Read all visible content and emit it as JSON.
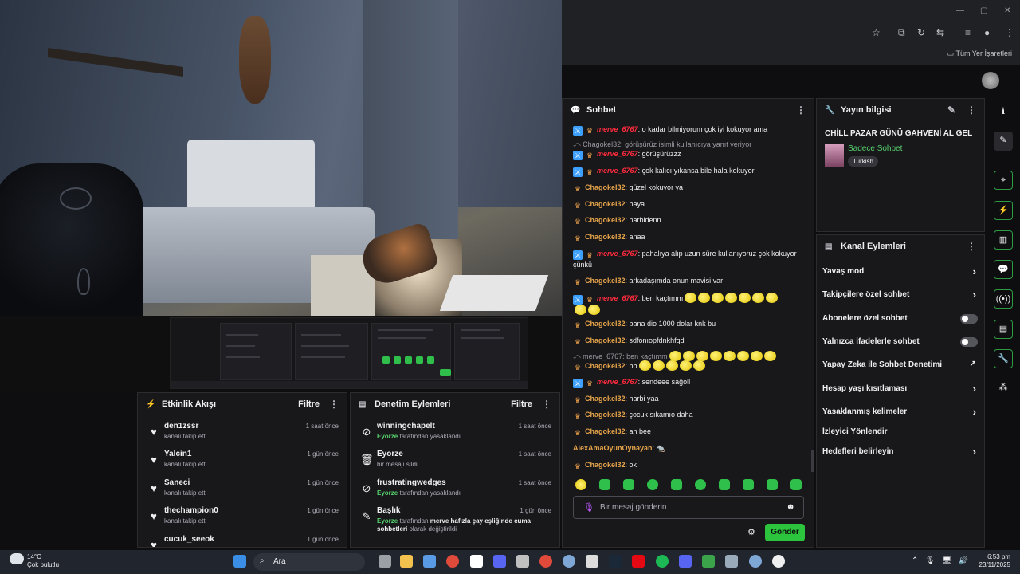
{
  "browser": {
    "bookmark_folder": "Tüm Yer İşaretleri"
  },
  "chat": {
    "title": "Sohbet",
    "messages": [
      {
        "user": "merve_6767",
        "text": ": o kadar bilmiyorum çok iyi kokuyor ama"
      },
      {
        "reply": "Chagokel32: görüşürüz isimli kullanıcıya yanıt veriyor"
      },
      {
        "user": "merve_6767",
        "text": ": görüşürüzzz"
      },
      {
        "user": "merve_6767",
        "text": ": çok kalıcı yıkansa bile hala kokuyor"
      },
      {
        "user": "Chagokel32",
        "text": ": güzel kokuyor ya"
      },
      {
        "user": "Chagokel32",
        "text": ": baya"
      },
      {
        "user": "Chagokel32",
        "text": ": harbidenn"
      },
      {
        "user": "Chagokel32",
        "text": ": anaa"
      },
      {
        "user": "merve_6767",
        "text": ": pahalıya alıp uzun süre kullanıyoruz çok kokuyor",
        "text2": "çünkü"
      },
      {
        "user": "Chagokel32",
        "text": ": arkadaşımda onun mavisi var"
      },
      {
        "user": "merve_6767",
        "text": ": ben kaçtımm"
      },
      {
        "user": "Chagokel32",
        "text": ": bana dio 1000 dolar knk bu"
      },
      {
        "user": "Chagokel32",
        "text": ": sdfonıopfdnkhfgd"
      },
      {
        "reply": "merve_6767: ben kaçtımm"
      },
      {
        "user": "Chagokel32",
        "text": ": bb"
      },
      {
        "user": "merve_6767",
        "text": ": sendeee sağoll"
      },
      {
        "user": "Chagokel32",
        "text": ": harbi yaa"
      },
      {
        "user": "Chagokel32",
        "text": ": çocuk sıkamıo daha"
      },
      {
        "user": "Chagokel32",
        "text": ": ah bee"
      },
      {
        "user": "AlexAmaOyunOynayan",
        "text": ":"
      },
      {
        "user": "Chagokel32",
        "text": ": ok"
      }
    ],
    "input_placeholder": "Bir mesaj gönderin",
    "send_label": "Gönder"
  },
  "stream_info": {
    "title": "Yayın bilgisi",
    "stream_title": "CHİLL PAZAR GÜNÜ GAHVENİ AL GEL",
    "category": "Sadece Sohbet",
    "tag": "Turkish"
  },
  "channel_actions": {
    "title": "Kanal Eylemleri",
    "items": [
      {
        "label": "Yavaş mod",
        "kind": "chevron"
      },
      {
        "label": "Takipçilere özel sohbet",
        "kind": "chevron"
      },
      {
        "label": "Abonelere özel sohbet",
        "kind": "toggle"
      },
      {
        "label": "Yalnızca ifadelerle sohbet",
        "kind": "toggle"
      },
      {
        "label": "Yapay Zeka ile Sohbet Denetimi",
        "kind": "external"
      },
      {
        "label": "Hesap yaşı kısıtlaması",
        "kind": "chevron"
      },
      {
        "label": "Yasaklanmış kelimeler",
        "kind": "chevron"
      },
      {
        "label": "İzleyici Yönlendir",
        "kind": "none"
      },
      {
        "label": "Hedefleri belirleyin",
        "kind": "chevron"
      }
    ]
  },
  "activity": {
    "title": "Etkinlik Akışı",
    "filter": "Filtre",
    "items": [
      {
        "name": "den1zssr",
        "desc": "kanalı takip etti",
        "time": "1 saat önce"
      },
      {
        "name": "Yalcin1",
        "desc": "kanalı takip etti",
        "time": "1 gün önce"
      },
      {
        "name": "Saneci",
        "desc": "kanalı takip etti",
        "time": "1 gün önce"
      },
      {
        "name": "thechampion0",
        "desc": "kanalı takip etti",
        "time": "1 gün önce"
      },
      {
        "name": "cucuk_seeok",
        "desc": "",
        "time": "1 gün önce"
      }
    ]
  },
  "moderation": {
    "title": "Denetim Eylemleri",
    "filter": "Filtre",
    "items": [
      {
        "name": "winningchapelt",
        "actor": "Eyorze",
        "desc": " tarafından yasaklandı",
        "time": "1 saat önce"
      },
      {
        "name": "Eyorze",
        "actor": "",
        "desc": "bir mesajı sildi",
        "time": "1 saat önce"
      },
      {
        "name": "frustratingwedges",
        "actor": "Eyorze",
        "desc": " tarafından yasaklandı",
        "time": "1 saat önce"
      },
      {
        "name": "Başlık",
        "actor": "Eyorze",
        "desc": " tarafından ",
        "bold": "merve hafızla çay eşliğinde cuma",
        "desc2_bold": "sohbetleri",
        "desc2": " olarak değiştirildi",
        "time": "1 gün önce"
      }
    ]
  },
  "taskbar": {
    "temp": "14°C",
    "weather": "Çok bulutlu",
    "search": "Ara",
    "time": "6:53 pm",
    "date": "23/11/2025"
  },
  "colors": {
    "accent_green": "#2cc43c",
    "mod_red": "#ff2a3c",
    "sub_orange": "#e8a54a",
    "panel_bg": "#18181b"
  }
}
